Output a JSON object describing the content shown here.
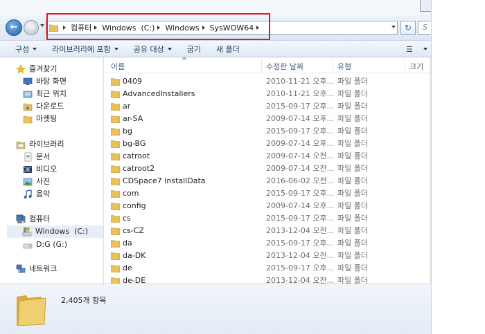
{
  "window": {
    "address": {
      "crumbs": [
        "컴퓨터",
        "Windows  (C:)",
        "Windows",
        "SysWOW64"
      ],
      "search_placeholder": "S"
    },
    "toolbar": {
      "organize": "구성",
      "include_library": "라이브러리에 포함",
      "share_with": "공유 대상",
      "burn": "굽기",
      "new_folder": "새 폴더"
    },
    "nav_pane": {
      "favorites": {
        "header": "즐겨찾기",
        "items": [
          "바탕 화면",
          "최근 위치",
          "다운로드",
          "마켓팅"
        ]
      },
      "libraries": {
        "header": "라이브러리",
        "items": [
          "문서",
          "비디오",
          "사진",
          "음악"
        ]
      },
      "computer": {
        "header": "컴퓨터",
        "items": [
          "Windows  (C:)",
          "D:G (G:)"
        ]
      },
      "network": {
        "header": "네트워크"
      }
    },
    "columns": [
      "이름",
      "수정한 날짜",
      "유형",
      "크기"
    ],
    "files": [
      {
        "name": "0409",
        "date": "2010-11-21 오후...",
        "type": "파일 폴더"
      },
      {
        "name": "AdvancedInstallers",
        "date": "2010-11-21 오후...",
        "type": "파일 폴더"
      },
      {
        "name": "ar",
        "date": "2015-09-17 오후...",
        "type": "파일 폴더"
      },
      {
        "name": "ar-SA",
        "date": "2009-07-14 오후...",
        "type": "파일 폴더"
      },
      {
        "name": "bg",
        "date": "2015-09-17 오후...",
        "type": "파일 폴더"
      },
      {
        "name": "bg-BG",
        "date": "2009-07-14 오후...",
        "type": "파일 폴더"
      },
      {
        "name": "catroot",
        "date": "2009-07-14 오전...",
        "type": "파일 폴더"
      },
      {
        "name": "catroot2",
        "date": "2009-07-14 오전...",
        "type": "파일 폴더"
      },
      {
        "name": "CDSpace7 InstallData",
        "date": "2016-06-02 오전...",
        "type": "파일 폴더"
      },
      {
        "name": "com",
        "date": "2015-09-17 오후...",
        "type": "파일 폴더"
      },
      {
        "name": "config",
        "date": "2009-07-14 오후...",
        "type": "파일 폴더"
      },
      {
        "name": "cs",
        "date": "2015-09-17 오후...",
        "type": "파일 폴더"
      },
      {
        "name": "cs-CZ",
        "date": "2013-12-04 오전...",
        "type": "파일 폴더"
      },
      {
        "name": "da",
        "date": "2015-09-17 오후...",
        "type": "파일 폴더"
      },
      {
        "name": "da-DK",
        "date": "2013-12-04 오전...",
        "type": "파일 폴더"
      },
      {
        "name": "de",
        "date": "2015-09-17 오후...",
        "type": "파일 폴더"
      },
      {
        "name": "de-DE",
        "date": "2013-12-04 오전...",
        "type": "파일 폴더"
      }
    ],
    "details": {
      "item_count": "2,405개 항목"
    },
    "colors": {
      "highlight": "#e8141c",
      "folder": "#e8c15a",
      "accent": "#1e395b"
    }
  }
}
